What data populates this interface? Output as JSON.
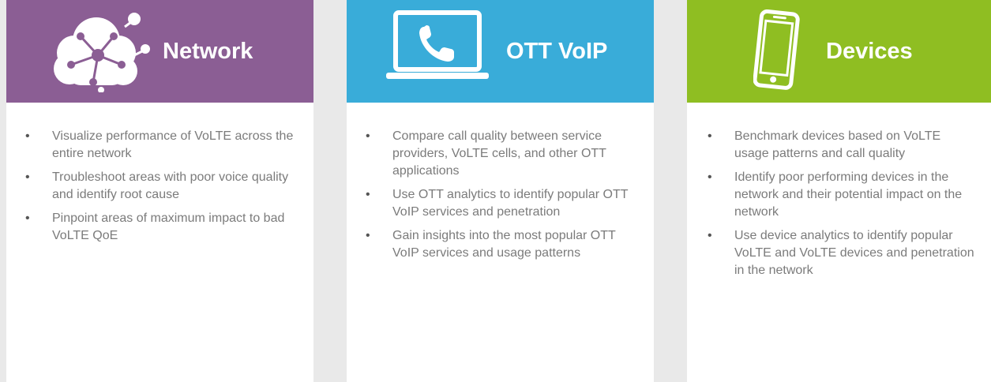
{
  "colors": {
    "network": "#8b5e94",
    "ott": "#39acd9",
    "devices": "#8fbe22",
    "background": "#e9e9e9",
    "text": "#7b7b7b"
  },
  "cards": [
    {
      "title": "Network",
      "icon": "cloud-network-icon",
      "bullets": [
        "Visualize performance of VoLTE across the entire network",
        "Troubleshoot areas with poor voice quality and identify root cause",
        "Pinpoint areas of maximum impact to bad VoLTE QoE"
      ]
    },
    {
      "title": "OTT VoIP",
      "icon": "laptop-phone-icon",
      "bullets": [
        "Compare call quality between service providers, VoLTE cells, and other OTT applications",
        "Use OTT analytics to identify popular OTT VoIP services and penetration",
        "Gain insights into the most popular OTT VoIP services and usage patterns"
      ]
    },
    {
      "title": "Devices",
      "icon": "smartphone-icon",
      "bullets": [
        "Benchmark devices based on VoLTE usage patterns and call quality",
        "Identify poor performing devices in the network and their potential impact on the network",
        "Use device analytics to identify popular VoLTE and VoLTE devices and penetration in the network"
      ]
    }
  ]
}
